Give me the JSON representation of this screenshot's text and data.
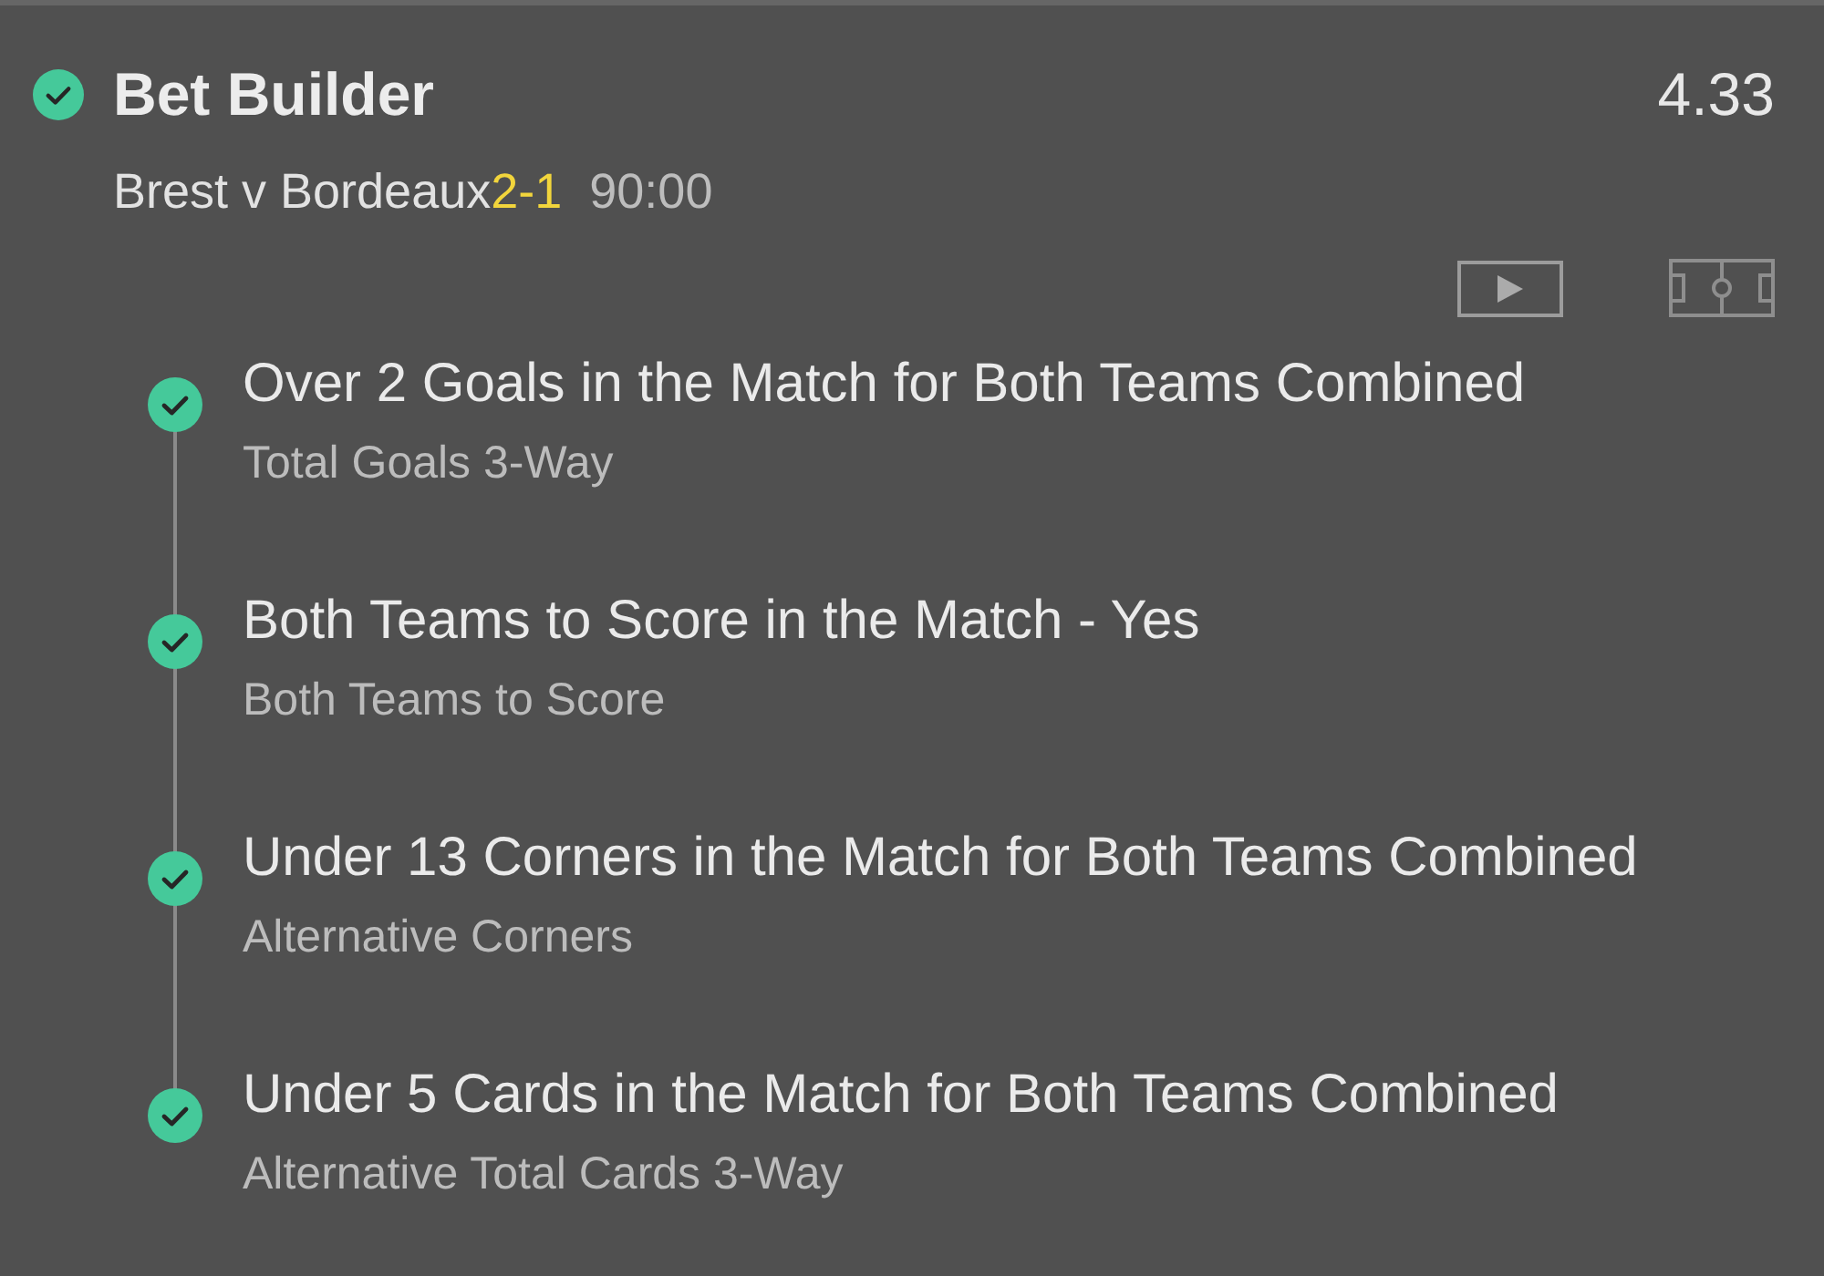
{
  "header": {
    "checked": true,
    "title": "Bet Builder",
    "odds": "4.33",
    "match": "Brest v Bordeaux",
    "score": "2-1",
    "clock": "90:00"
  },
  "selections": [
    {
      "checked": true,
      "title": "Over 2 Goals in the Match for Both Teams Combined",
      "market": "Total Goals 3-Way"
    },
    {
      "checked": true,
      "title": "Both Teams to Score in the Match - Yes",
      "market": "Both Teams to Score"
    },
    {
      "checked": true,
      "title": "Under 13 Corners in the Match for Both Teams Combined",
      "market": "Alternative Corners"
    },
    {
      "checked": true,
      "title": "Under 5 Cards in the Match for Both Teams Combined",
      "market": "Alternative Total Cards 3-Way"
    }
  ]
}
